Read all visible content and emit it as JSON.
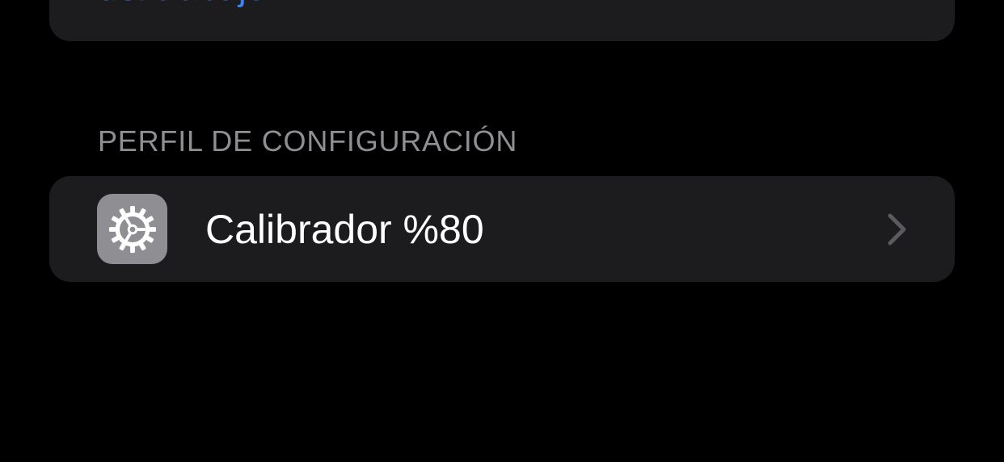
{
  "top_card": {
    "link_text": "del trabajo..."
  },
  "section": {
    "header": "PERFIL DE CONFIGURACIÓN"
  },
  "profile": {
    "icon": "settings-gear-icon",
    "label": "Calibrador %80",
    "chevron_icon": "chevron-right-icon"
  },
  "colors": {
    "background": "#000000",
    "card": "#1c1c1e",
    "link": "#3b82f6",
    "header_text": "#8e8e93",
    "icon_bg": "#8e8e93",
    "label_text": "#ffffff",
    "chevron": "#5a5a5f"
  }
}
